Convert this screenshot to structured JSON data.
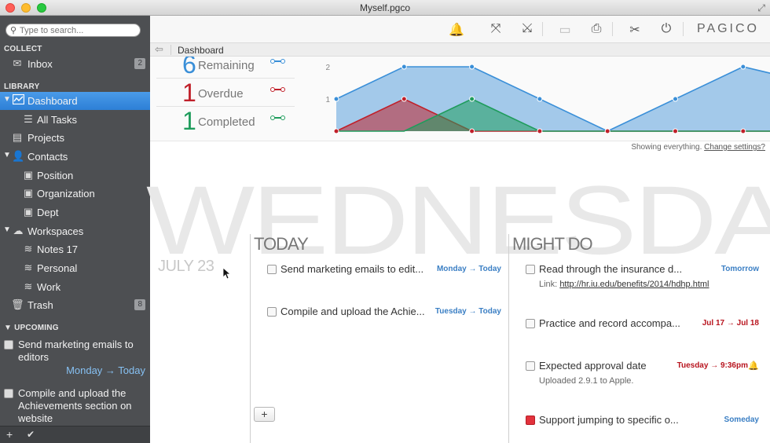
{
  "window": {
    "title": "Myself.pgco"
  },
  "search": {
    "placeholder": "Type to search..."
  },
  "sidebar": {
    "collect_header": "COLLECT",
    "inbox": {
      "label": "Inbox",
      "count": "2"
    },
    "library_header": "LIBRARY",
    "items": [
      {
        "label": "Dashboard",
        "icon": "dashboard-icon"
      },
      {
        "label": "All Tasks",
        "icon": "list-icon"
      },
      {
        "label": "Projects",
        "icon": "projects-icon"
      },
      {
        "label": "Contacts",
        "icon": "person-icon"
      },
      {
        "label": "Position",
        "icon": "contact-card-icon"
      },
      {
        "label": "Organization",
        "icon": "contact-card-icon"
      },
      {
        "label": "Dept",
        "icon": "contact-card-icon"
      },
      {
        "label": "Workspaces",
        "icon": "cloud-icon"
      },
      {
        "label": "Notes 17",
        "icon": "wifi-icon"
      },
      {
        "label": "Personal",
        "icon": "wifi-icon"
      },
      {
        "label": "Work",
        "icon": "wifi-icon"
      },
      {
        "label": "Trash",
        "icon": "trash-icon",
        "count": "8"
      }
    ],
    "upcoming_header": "UPCOMING",
    "upcoming": [
      {
        "title": "Send marketing emails to editors",
        "when": "Monday → Today"
      },
      {
        "title": "Compile and upload the Achievements section on website"
      }
    ]
  },
  "toolbar": {
    "icons": [
      "bell-icon",
      "expand-icon",
      "collapse-icon",
      "archive-icon",
      "print-icon",
      "tools-icon",
      "power-icon"
    ],
    "brand": "PAGICO"
  },
  "breadcrumb": {
    "current": "Dashboard"
  },
  "stats": [
    {
      "number": "6",
      "label": "Remaining",
      "color": "#3a8fd8"
    },
    {
      "number": "1",
      "label": "Overdue",
      "color": "#c0202a"
    },
    {
      "number": "1",
      "label": "Completed",
      "color": "#1f9c5c"
    }
  ],
  "chart_data": {
    "type": "area",
    "y_ticks": [
      "2",
      "1"
    ],
    "ylim": [
      0,
      2
    ],
    "series": [
      {
        "color": "#3a8fd8",
        "values": [
          1,
          2,
          2,
          1,
          0,
          1,
          2,
          1.5
        ]
      },
      {
        "color": "#c0202a",
        "values": [
          0,
          1,
          0,
          0,
          0,
          0,
          0,
          0
        ]
      },
      {
        "color": "#1f9c5c",
        "values": [
          0,
          0,
          1,
          0,
          0,
          0,
          0,
          0
        ]
      }
    ]
  },
  "showing": {
    "text": "Showing everything.",
    "link": "Change settings?"
  },
  "day": {
    "weekday": "WEDNESDAY",
    "date": "JULY 23"
  },
  "today": {
    "header": "TODAY",
    "tasks": [
      {
        "title": "Send marketing emails to edit...",
        "due": "Monday → Today"
      },
      {
        "title": "Compile and upload the Achie...",
        "due": "Tuesday → Today"
      }
    ],
    "add_label": "+"
  },
  "might_do": {
    "header": "MIGHT DO",
    "tasks": [
      {
        "title": "Read through the insurance d...",
        "due": "Tomorrow",
        "sub_label": "Link:",
        "sub_link": "http://hr.iu.edu/benefits/2014/hdhp.html"
      },
      {
        "title": "Practice and record accompa...",
        "due": "Jul 17 → Jul 18"
      },
      {
        "title": "Expected approval date",
        "due": "Tuesday → 9:36pm",
        "sub": "Uploaded 2.9.1 to Apple."
      },
      {
        "title": "Support jumping to specific o...",
        "due": "Someday"
      }
    ]
  }
}
